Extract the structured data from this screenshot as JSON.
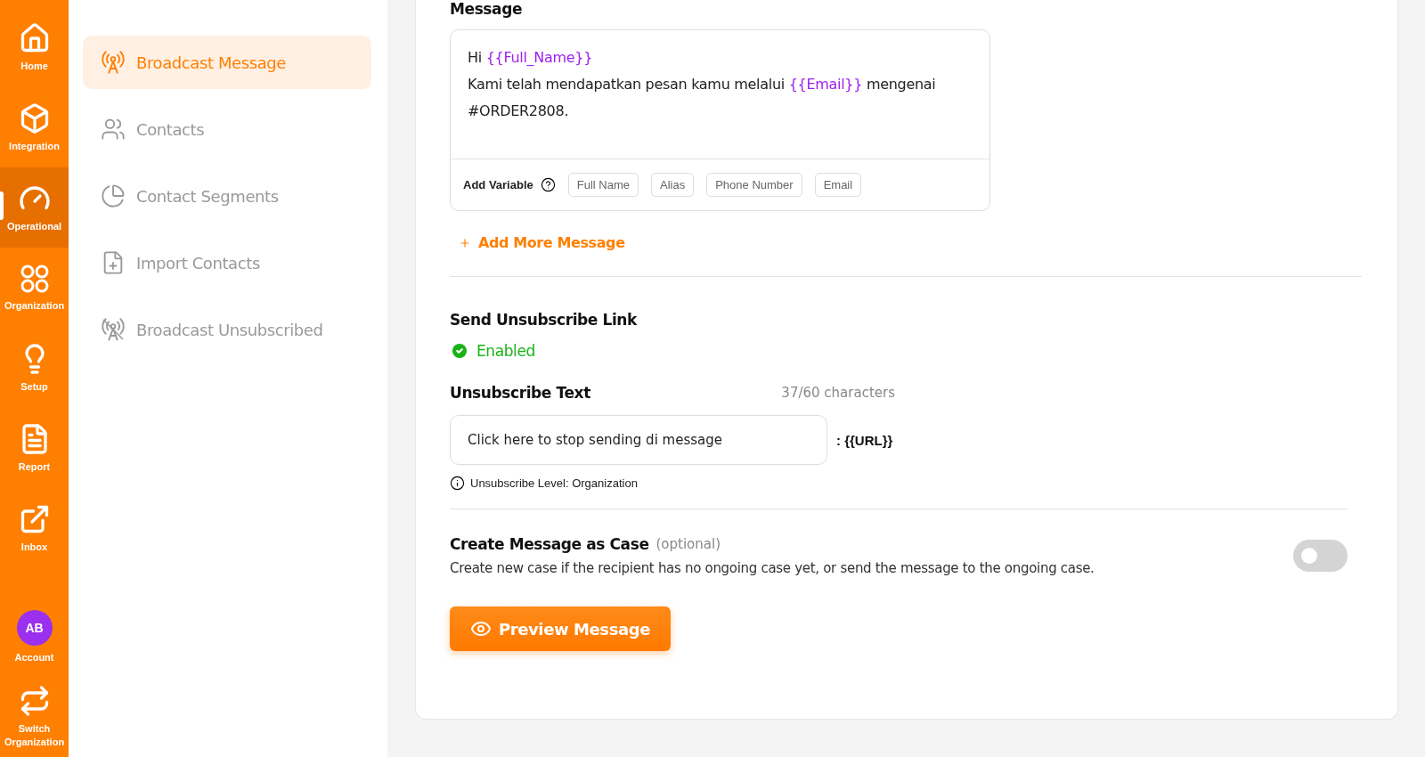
{
  "rail": {
    "items": [
      {
        "kind": "home",
        "label": "Home",
        "selected": false
      },
      {
        "kind": "integration",
        "label": "Integration",
        "selected": false
      },
      {
        "kind": "operational",
        "label": "Operational",
        "selected": true
      },
      {
        "kind": "organization",
        "label": "Organization",
        "selected": false
      },
      {
        "kind": "setup",
        "label": "Setup",
        "selected": false
      },
      {
        "kind": "report",
        "label": "Report",
        "selected": false
      },
      {
        "kind": "inbox",
        "label": "Inbox",
        "selected": false
      }
    ],
    "account": {
      "initials": "AB",
      "label": "Account"
    },
    "switch": {
      "label": "Switch Organization"
    }
  },
  "submenu": {
    "items": [
      {
        "kind": "broadcast",
        "label": "Broadcast Message",
        "selected": true
      },
      {
        "kind": "contacts",
        "label": "Contacts",
        "selected": false
      },
      {
        "kind": "segments",
        "label": "Contact Segments",
        "selected": false
      },
      {
        "kind": "import",
        "label": "Import Contacts",
        "selected": false
      },
      {
        "kind": "unsubscribed",
        "label": "Broadcast Unsubscribed",
        "selected": false
      }
    ]
  },
  "message": {
    "label": "Message",
    "lines": [
      [
        {
          "kind": "text",
          "text": "Hi "
        },
        {
          "kind": "variable",
          "text": "{{Full_Name}}"
        }
      ],
      [
        {
          "kind": "text",
          "text": "Kami telah mendapatkan pesan kamu melalui "
        },
        {
          "kind": "variable",
          "text": "{{Email}}"
        },
        {
          "kind": "text",
          "text": " mengenai"
        }
      ],
      [
        {
          "kind": "text",
          "text": "#ORDER2808."
        }
      ]
    ],
    "add_variable": {
      "label": "Add Variable",
      "chips": [
        "Full Name",
        "Alias",
        "Phone Number",
        "Email"
      ]
    },
    "add_more": "Add More Message"
  },
  "unsubscribe": {
    "title": "Send Unsubscribe Link",
    "status": {
      "label": "Enabled",
      "enabled": true
    },
    "text_label": "Unsubscribe Text",
    "counter": "37/60 characters",
    "value": "Click here to stop sending di message",
    "suffix": ": {{URL}}",
    "level": "Unsubscribe Level: Organization"
  },
  "case": {
    "title": "Create Message as Case",
    "optional": "(optional)",
    "description": "Create new case if the recipient has no ongoing case yet, or send the message to the ongoing case.",
    "on": false
  },
  "preview_button": "Preview Message"
}
